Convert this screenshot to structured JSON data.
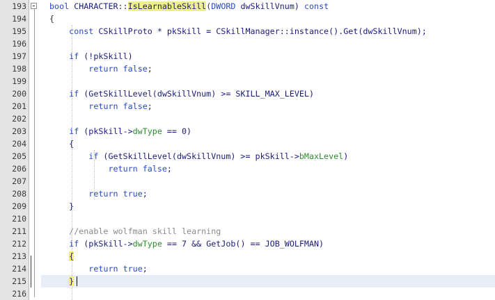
{
  "editor": {
    "lines": [
      {
        "num": "193",
        "tokens": [
          {
            "t": "bool ",
            "c": "kw"
          },
          {
            "t": "CHARACTER",
            "c": "fn"
          },
          {
            "t": "::",
            "c": "op"
          },
          {
            "t": "IsLearnableSkill",
            "c": "hl"
          },
          {
            "t": "(",
            "c": "op"
          },
          {
            "t": "DWORD",
            "c": "ty"
          },
          {
            "t": " dwSkillVnum) ",
            "c": "fn"
          },
          {
            "t": "const",
            "c": "kw"
          }
        ]
      },
      {
        "num": "194",
        "tokens": [
          {
            "t": "{",
            "c": "op"
          }
        ]
      },
      {
        "num": "195",
        "tokens": [
          {
            "t": "    ",
            "c": "fn"
          },
          {
            "t": "const",
            "c": "kw"
          },
          {
            "t": " CSkillProto * pkSkill = CSkillManager::instance().Get(dwSkillVnum);",
            "c": "fn"
          }
        ]
      },
      {
        "num": "196",
        "tokens": []
      },
      {
        "num": "197",
        "tokens": [
          {
            "t": "    ",
            "c": "fn"
          },
          {
            "t": "if",
            "c": "kw"
          },
          {
            "t": " (!pkSkill)",
            "c": "fn"
          }
        ]
      },
      {
        "num": "198",
        "tokens": [
          {
            "t": "        ",
            "c": "fn"
          },
          {
            "t": "return",
            "c": "kw"
          },
          {
            "t": " ",
            "c": "fn"
          },
          {
            "t": "false",
            "c": "kw"
          },
          {
            "t": ";",
            "c": "fn"
          }
        ]
      },
      {
        "num": "199",
        "tokens": []
      },
      {
        "num": "200",
        "tokens": [
          {
            "t": "    ",
            "c": "fn"
          },
          {
            "t": "if",
            "c": "kw"
          },
          {
            "t": " (GetSkillLevel(dwSkillVnum) >= SKILL_MAX_LEVEL)",
            "c": "fn"
          }
        ]
      },
      {
        "num": "201",
        "tokens": [
          {
            "t": "        ",
            "c": "fn"
          },
          {
            "t": "return",
            "c": "kw"
          },
          {
            "t": " ",
            "c": "fn"
          },
          {
            "t": "false",
            "c": "kw"
          },
          {
            "t": ";",
            "c": "fn"
          }
        ]
      },
      {
        "num": "202",
        "tokens": []
      },
      {
        "num": "203",
        "tokens": [
          {
            "t": "    ",
            "c": "fn"
          },
          {
            "t": "if",
            "c": "kw"
          },
          {
            "t": " (pkSkill->",
            "c": "fn"
          },
          {
            "t": "dwType",
            "c": "mem"
          },
          {
            "t": " == 0)",
            "c": "fn"
          }
        ]
      },
      {
        "num": "204",
        "tokens": [
          {
            "t": "    {",
            "c": "fn"
          }
        ]
      },
      {
        "num": "205",
        "tokens": [
          {
            "t": "        ",
            "c": "fn"
          },
          {
            "t": "if",
            "c": "kw"
          },
          {
            "t": " (GetSkillLevel(dwSkillVnum) >= pkSkill->",
            "c": "fn"
          },
          {
            "t": "bMaxLevel",
            "c": "mem"
          },
          {
            "t": ")",
            "c": "fn"
          }
        ]
      },
      {
        "num": "206",
        "tokens": [
          {
            "t": "            ",
            "c": "fn"
          },
          {
            "t": "return",
            "c": "kw"
          },
          {
            "t": " ",
            "c": "fn"
          },
          {
            "t": "false",
            "c": "kw"
          },
          {
            "t": ";",
            "c": "fn"
          }
        ]
      },
      {
        "num": "207",
        "tokens": []
      },
      {
        "num": "208",
        "tokens": [
          {
            "t": "        ",
            "c": "fn"
          },
          {
            "t": "return",
            "c": "kw"
          },
          {
            "t": " ",
            "c": "fn"
          },
          {
            "t": "true",
            "c": "kw"
          },
          {
            "t": ";",
            "c": "fn"
          }
        ]
      },
      {
        "num": "209",
        "tokens": [
          {
            "t": "    }",
            "c": "fn"
          }
        ]
      },
      {
        "num": "210",
        "tokens": []
      },
      {
        "num": "211",
        "tokens": [
          {
            "t": "    ",
            "c": "fn"
          },
          {
            "t": "//enable wolfman skill learning",
            "c": "cm"
          }
        ]
      },
      {
        "num": "212",
        "tokens": [
          {
            "t": "    ",
            "c": "fn"
          },
          {
            "t": "if",
            "c": "kw"
          },
          {
            "t": " (pkSkill->",
            "c": "fn"
          },
          {
            "t": "dwType",
            "c": "mem"
          },
          {
            "t": " == 7 && GetJob() == JOB_WOLFMAN)",
            "c": "fn"
          }
        ]
      },
      {
        "num": "213",
        "tokens": [
          {
            "t": "    ",
            "c": "fn"
          },
          {
            "t": "{",
            "c": "brace-hl"
          }
        ]
      },
      {
        "num": "214",
        "tokens": [
          {
            "t": "        ",
            "c": "fn"
          },
          {
            "t": "return",
            "c": "kw"
          },
          {
            "t": " ",
            "c": "fn"
          },
          {
            "t": "true",
            "c": "kw"
          },
          {
            "t": ";",
            "c": "fn"
          }
        ]
      },
      {
        "num": "215",
        "tokens": [
          {
            "t": "    ",
            "c": "fn"
          },
          {
            "t": "}",
            "c": "brace-hl"
          }
        ]
      },
      {
        "num": "216",
        "tokens": []
      }
    ]
  },
  "colors": {
    "keyword": "#2a49c4",
    "member": "#2f8b2f",
    "comment": "#8a8a8a",
    "highlight": "#f0f08a",
    "gutter": "#e4e4e4"
  }
}
